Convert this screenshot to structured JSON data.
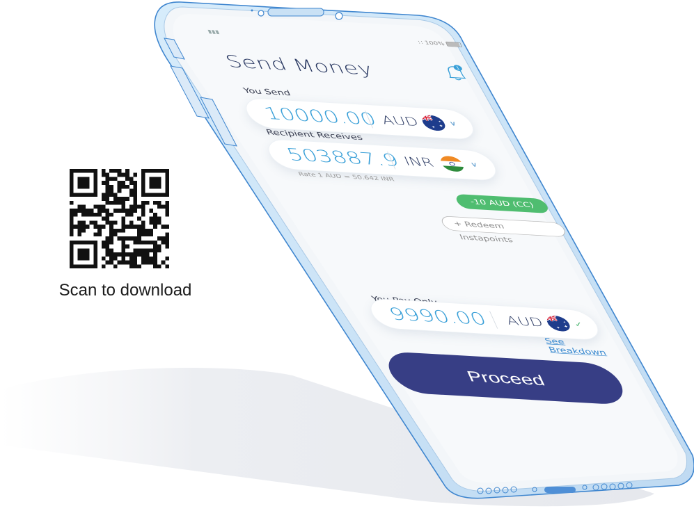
{
  "qr": {
    "caption": "Scan to download"
  },
  "status": {
    "signal": "••••",
    "battery": "100%"
  },
  "screen": {
    "title": "Send Money",
    "notification_count": "1",
    "you_send": {
      "label": "You Send",
      "amount": "10000.00",
      "currency": "AUD",
      "flag": "australia-flag"
    },
    "recipient": {
      "label": "Recipient Receives",
      "amount": "503887.9",
      "currency": "INR",
      "flag": "india-flag"
    },
    "rate": "Rate 1 AUD = 50.642 INR",
    "discount_badge": "-10 AUD (CC)",
    "redeem_label": "+ Redeem Instapoints",
    "you_pay": {
      "label": "You Pay Only",
      "amount": "9990.00",
      "currency": "AUD",
      "flag": "australia-flag"
    },
    "breakdown_link": "See Breakdown",
    "proceed_label": "Proceed"
  },
  "colors": {
    "brand": "#373e85",
    "accent": "#3aa0d8",
    "success": "#4fbd70",
    "title": "#2b3a63"
  }
}
